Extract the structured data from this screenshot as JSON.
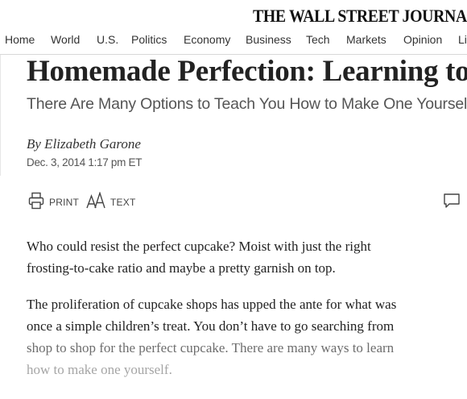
{
  "masthead": {
    "logo": "THE WALL STREET JOURNAL."
  },
  "nav": {
    "items": [
      "Home",
      "World",
      "U.S.",
      "Politics",
      "Economy",
      "Business",
      "Tech",
      "Markets",
      "Opinion",
      "Li"
    ]
  },
  "article": {
    "headline": "Homemade Perfection: Learning to",
    "dek": "There Are Many Options to Teach You How to Make One Yourself",
    "byline": "By Elizabeth Garone",
    "timestamp": "Dec. 3, 2014 1:17 pm ET",
    "tools": {
      "print_label": "PRINT",
      "text_label": "TEXT"
    },
    "paragraphs": [
      [
        "Who could resist the perfect cupcake? Moist with just the right",
        "frosting-to-cake ratio and maybe a pretty garnish on top."
      ],
      [
        "The proliferation of cupcake shops has upped the ante for what was",
        "once a simple children’s treat. You don’t have to go searching from",
        "shop to shop for the perfect cupcake. There are many ways to learn",
        "how to make one yourself."
      ]
    ]
  }
}
